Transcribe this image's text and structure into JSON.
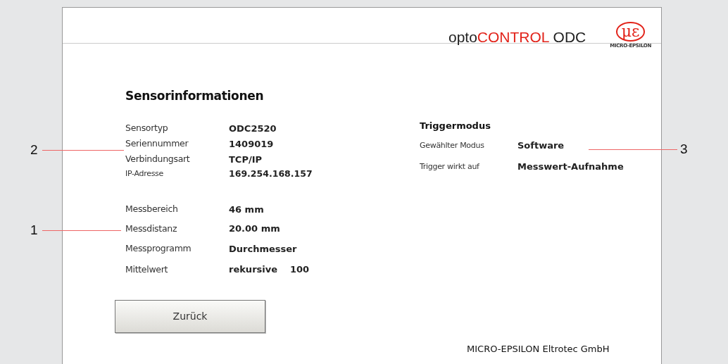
{
  "header": {
    "product_prefix": "opto",
    "product_highlight": "CONTROL",
    "product_suffix": "ODC",
    "logo_mark": "με",
    "logo_text": "MICRO-EPSILON"
  },
  "title": "Sensorinformationen",
  "sensor_info": [
    {
      "label": "Sensortyp",
      "value": "ODC2520",
      "kind": "large"
    },
    {
      "label": "Seriennummer",
      "value": "1409019",
      "kind": "large"
    },
    {
      "label": "Verbindungsart",
      "value": "TCP/IP",
      "kind": "large"
    },
    {
      "label": "IP-Adresse",
      "value": "169.254.168.157",
      "kind": "small"
    }
  ],
  "measurement": [
    {
      "label": "Messbereich",
      "value": "46 mm"
    },
    {
      "label": "Messdistanz",
      "value": "20.00 mm"
    },
    {
      "label": "Messprogramm",
      "value": "Durchmesser"
    },
    {
      "label": "Mittelwert",
      "value": "rekursive",
      "value_2": "100"
    }
  ],
  "trigger": {
    "title": "Triggermodus",
    "rows": [
      {
        "label": "Gewählter Modus",
        "value": "Software"
      },
      {
        "label": "Trigger wirkt auf",
        "value": "Messwert-Aufnahme"
      }
    ]
  },
  "back_button": "Zurück",
  "footer": "MICRO-EPSILON Eltrotec GmbH",
  "callouts": [
    {
      "number": "2",
      "kind": "left"
    },
    {
      "number": "1",
      "kind": "left"
    },
    {
      "number": "3",
      "kind": "right"
    }
  ]
}
